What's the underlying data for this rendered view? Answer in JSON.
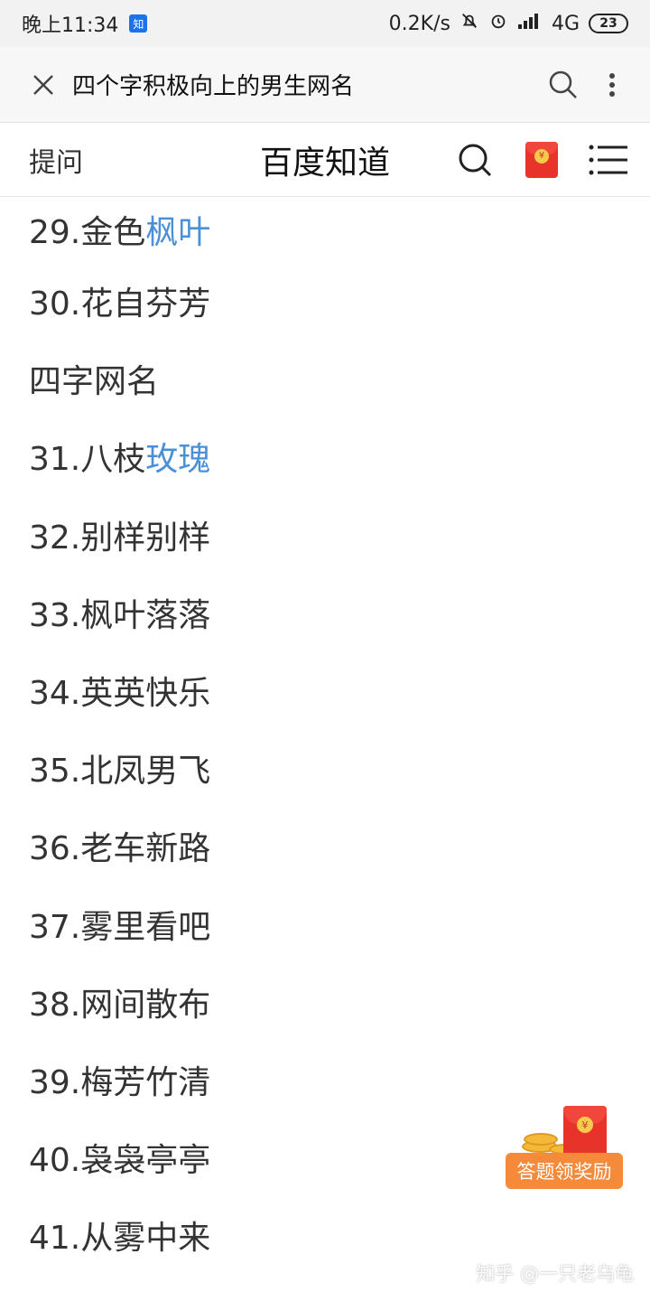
{
  "status": {
    "time": "晚上11:34",
    "app_badge": "知",
    "network_speed": "0.2K/s",
    "network_type": "4G",
    "battery": "23"
  },
  "browser": {
    "title": "四个字积极向上的男生网名"
  },
  "site": {
    "ask": "提问",
    "brand": "百度知道",
    "redpacket_symbol": "¥"
  },
  "items": [
    {
      "plain": "29.金色",
      "link": "枫叶"
    },
    {
      "plain": "30.花自芬芳",
      "link": ""
    },
    {
      "plain": "四字网名",
      "link": ""
    },
    {
      "plain": "31.八枝",
      "link": "玫瑰"
    },
    {
      "plain": "32.别样别样",
      "link": ""
    },
    {
      "plain": "33.枫叶落落",
      "link": ""
    },
    {
      "plain": "34.英英快乐",
      "link": ""
    },
    {
      "plain": "35.北凤男飞",
      "link": ""
    },
    {
      "plain": "36.老车新路",
      "link": ""
    },
    {
      "plain": "37.雾里看吧",
      "link": ""
    },
    {
      "plain": "38.网间散布",
      "link": ""
    },
    {
      "plain": "39.梅芳竹清",
      "link": ""
    },
    {
      "plain": "40.袅袅亭亭",
      "link": ""
    },
    {
      "plain": "41.从雾中来",
      "link": ""
    }
  ],
  "reward": {
    "label": "答题领奖励",
    "symbol": "¥"
  },
  "watermark": "知乎 @一只老乌龟",
  "colors": {
    "link": "#4a90d9",
    "reward_button": "#f58a3a",
    "redpacket": "#e8332a"
  }
}
